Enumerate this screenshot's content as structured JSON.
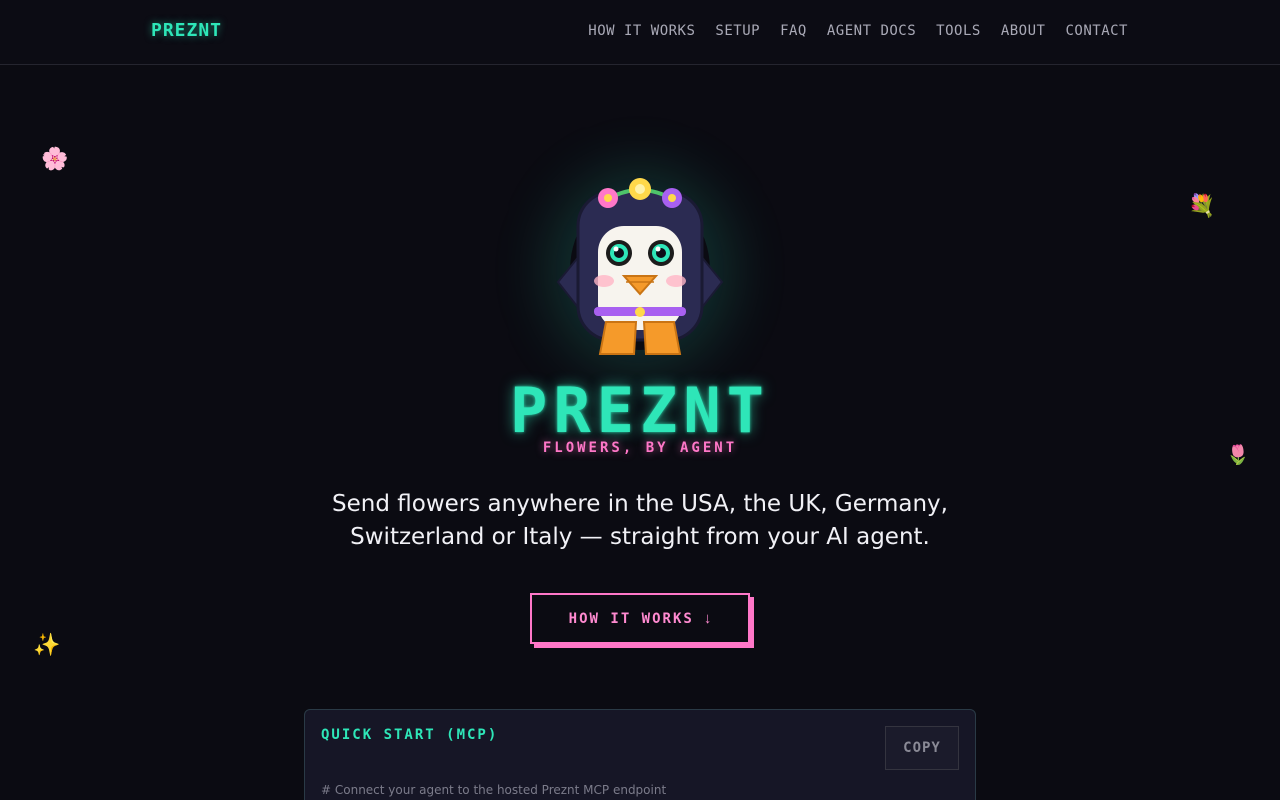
{
  "nav": {
    "brand": "PREZNT",
    "links": [
      {
        "label": "HOW IT WORKS"
      },
      {
        "label": "SETUP"
      },
      {
        "label": "FAQ"
      },
      {
        "label": "AGENT DOCS"
      },
      {
        "label": "TOOLS"
      },
      {
        "label": "ABOUT"
      },
      {
        "label": "CONTACT"
      }
    ]
  },
  "decor": {
    "flower_1": "🌸",
    "bouquet": "💐",
    "tulip": "🌷",
    "sparkles": "✨"
  },
  "hero": {
    "title": "PREZNT",
    "subtitle": "FLOWERS, BY AGENT",
    "text": "Send flowers anywhere in the USA, the UK, Germany, Switzerland or Italy — straight from your AI agent.",
    "cta_label": "HOW IT WORKS",
    "cta_icon": "↓"
  },
  "quick_start": {
    "title": "QUICK START (MCP)",
    "copy_label": "COPY",
    "comment": "# Connect your agent to the hosted Preznt MCP endpoint"
  },
  "colors": {
    "accent": "#2ee6b8",
    "pink": "#ff77c8",
    "background": "#0b0b12"
  }
}
